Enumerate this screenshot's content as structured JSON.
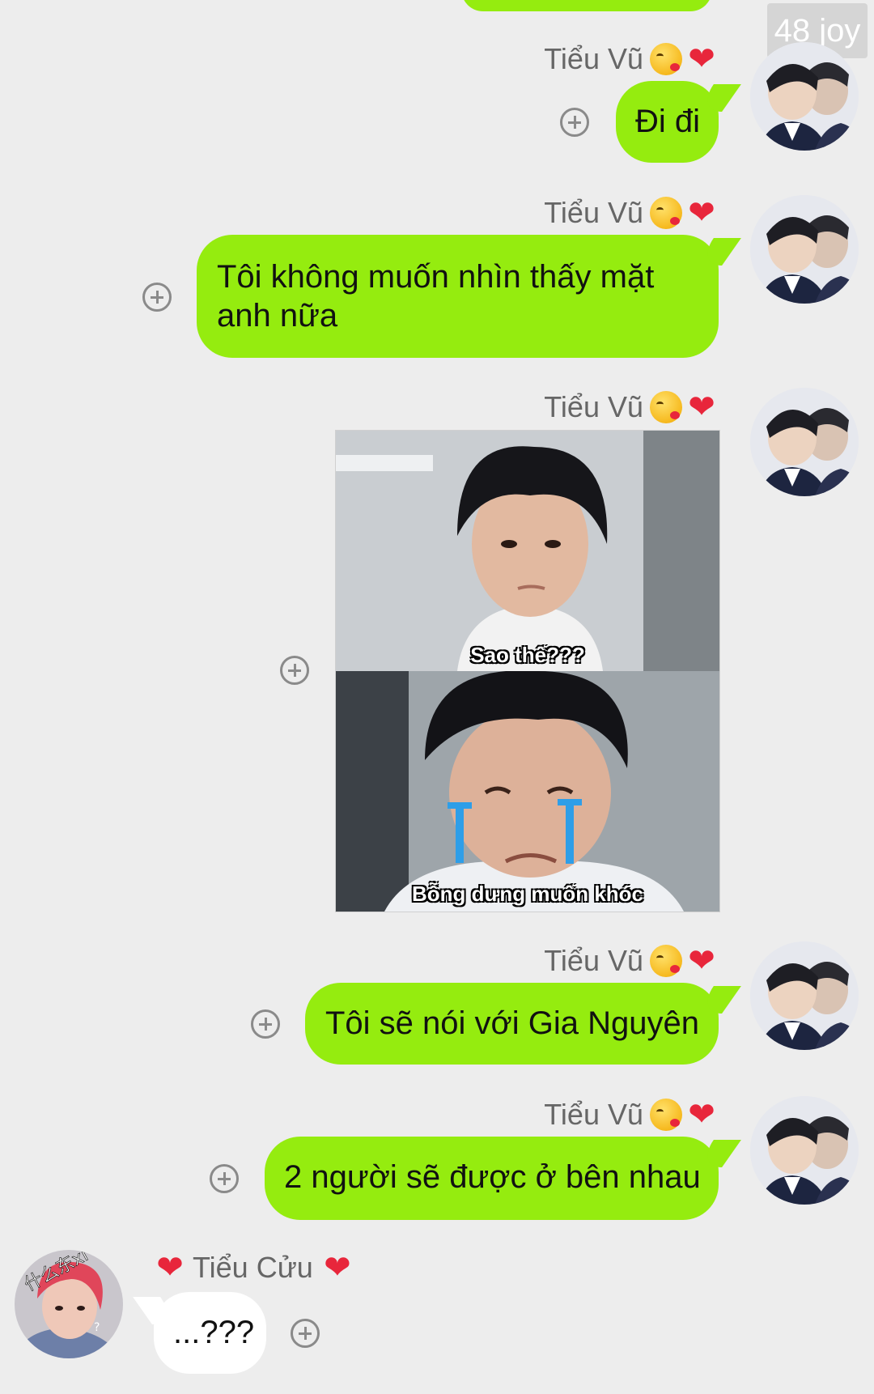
{
  "watermark": "48 joy",
  "colors": {
    "background": "#ededed",
    "outgoing_bubble": "#95ec0f",
    "incoming_bubble": "#ffffff",
    "name_text": "#666666"
  },
  "messages": [
    {
      "direction": "outgoing",
      "sender": "Tiểu Vũ",
      "sender_emojis": [
        "wink-kiss-icon",
        "red-heart-icon"
      ],
      "type": "text",
      "text": "Đi đi"
    },
    {
      "direction": "outgoing",
      "sender": "Tiểu Vũ",
      "sender_emojis": [
        "wink-kiss-icon",
        "red-heart-icon"
      ],
      "type": "text",
      "text": "Tôi không muốn nhìn thấy mặt anh nữa"
    },
    {
      "direction": "outgoing",
      "sender": "Tiểu Vũ",
      "sender_emojis": [
        "wink-kiss-icon",
        "red-heart-icon"
      ],
      "type": "image",
      "captions": [
        "Sao thế???",
        "Bỗng dưng muốn khóc"
      ]
    },
    {
      "direction": "outgoing",
      "sender": "Tiểu Vũ",
      "sender_emojis": [
        "wink-kiss-icon",
        "red-heart-icon"
      ],
      "type": "text",
      "text": "Tôi sẽ nói với Gia Nguyên"
    },
    {
      "direction": "outgoing",
      "sender": "Tiểu Vũ",
      "sender_emojis": [
        "wink-kiss-icon",
        "red-heart-icon"
      ],
      "type": "text",
      "text": "2 người sẽ được ở bên nhau"
    },
    {
      "direction": "incoming",
      "sender": "Tiểu Cửu",
      "sender_emojis": [
        "red-heart-icon",
        "red-heart-icon"
      ],
      "avatar_text": "什么东xi",
      "type": "text",
      "text": "...???"
    }
  ]
}
